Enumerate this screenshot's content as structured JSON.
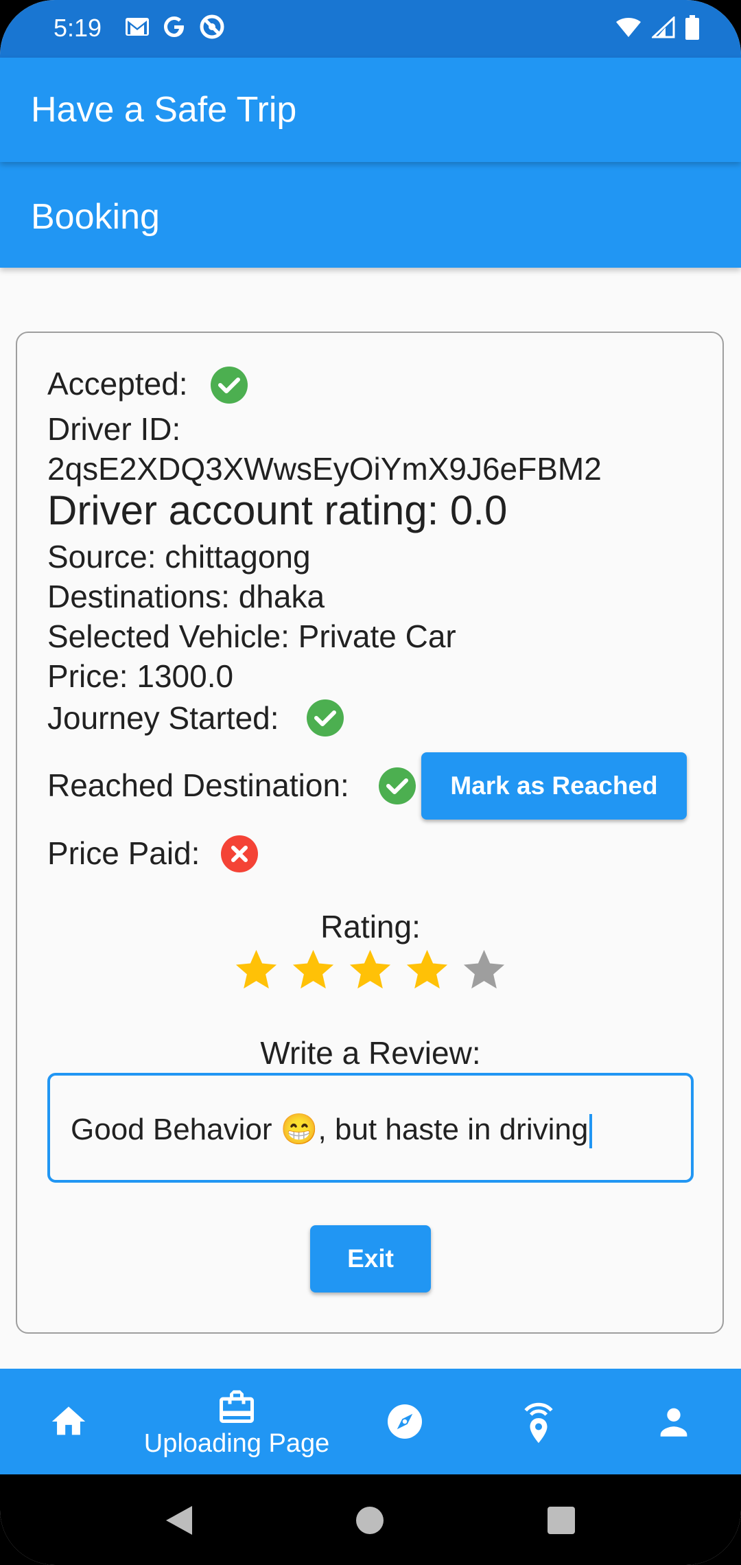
{
  "status": {
    "time": "5:19"
  },
  "app": {
    "title": "Have a Safe Trip",
    "section": "Booking"
  },
  "booking": {
    "accepted_label": "Accepted:",
    "driver_id_label": "Driver ID:",
    "driver_id": "2qsE2XDQ3XWwsEyOiYmX9J6eFBM2",
    "driver_rating": "Driver account rating: 0.0",
    "source": "Source: chittagong",
    "destinations": "Destinations: dhaka",
    "vehicle": "Selected Vehicle: Private Car",
    "price": "Price: 1300.0",
    "journey_started_label": "Journey Started:",
    "reached_label": "Reached Destination:",
    "mark_reached_button": "Mark as Reached",
    "price_paid_label": "Price Paid:"
  },
  "status_flags": {
    "accepted": true,
    "journey_started": true,
    "reached": true,
    "price_paid": false
  },
  "rating": {
    "label": "Rating:",
    "value": 4,
    "max": 5
  },
  "review": {
    "label": "Write a Review:",
    "value": "Good Behavior 😁, but haste in driving"
  },
  "exit_button": "Exit",
  "bottom_nav": {
    "active_label": "Uploading Page",
    "items": [
      "home-icon",
      "briefcase-icon",
      "compass-icon",
      "location-signal-icon",
      "person-icon"
    ]
  },
  "colors": {
    "primary": "#2196f3",
    "status_bar": "#1976d2",
    "success": "#4caf50",
    "error": "#f44336",
    "star_active": "#ffc107",
    "star_inactive": "#9e9e9e"
  }
}
